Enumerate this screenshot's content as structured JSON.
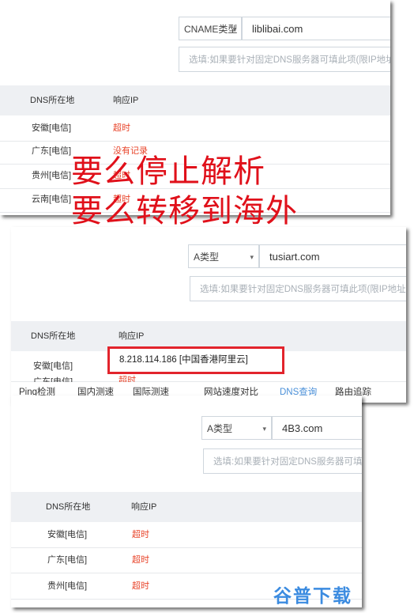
{
  "header_labels": {
    "dns_location": "DNS所在地",
    "response_ip": "响应IP"
  },
  "panel1": {
    "type_select": "CNAME类型",
    "domain": "liblibai.com",
    "ip_placeholder": "选填:如果要针对固定DNS服务器可填此项(限IP地址)",
    "rows": [
      {
        "location": "安徽[电信]",
        "status": "超时"
      },
      {
        "location": "广东[电信]",
        "status": "没有记录"
      },
      {
        "location": "贵州[电信]",
        "status": "超时"
      },
      {
        "location": "云南[电信]",
        "status": "超时"
      }
    ]
  },
  "overlay": {
    "line1": "要么停止解析",
    "line2": "要么转移到海外",
    "color": "#e0101a"
  },
  "panel2": {
    "type_select": "A类型",
    "domain": "tusiart.com",
    "ip_placeholder": "选填:如果要针对固定DNS服务器可填此项(限IP地址)",
    "row_location": "安徽[电信]",
    "row_ip": "8.218.114.186 [中国香港阿里云]",
    "partial_row_location": "广东[电信]",
    "partial_row_status": "超时",
    "tabs": [
      "Ping检测",
      "国内测速",
      "国际测速",
      "网站速度对比",
      "DNS查询",
      "路由追踪"
    ]
  },
  "panel3": {
    "type_select": "A类型",
    "domain": "4B3.com",
    "ip_placeholder": "选填:如果要针对固定DNS服务器可填此项(限IP地址)",
    "rows": [
      {
        "location": "安徽[电信]",
        "status": "超时"
      },
      {
        "location": "广东[电信]",
        "status": "超时"
      },
      {
        "location": "贵州[电信]",
        "status": "超时"
      }
    ]
  },
  "watermark": "谷普下载",
  "colors": {
    "timeout_red": "#e8442a",
    "highlight_border": "#e2242c",
    "active_tab_blue": "#4a90d9",
    "watermark_blue": "#3b8be0"
  }
}
